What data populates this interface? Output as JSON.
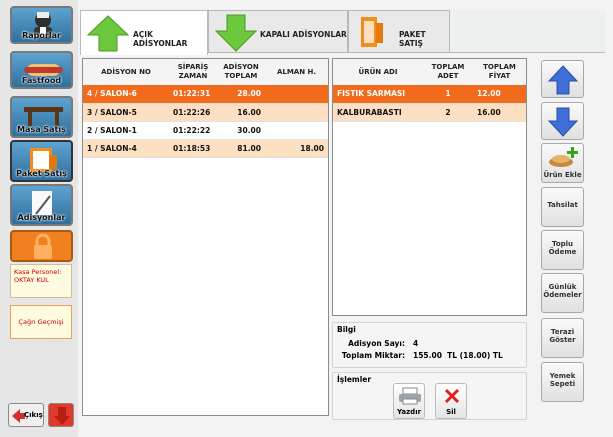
{
  "sidebar": {
    "reports_label": "Raporlar",
    "fastfood_label": "Fastfood",
    "table_sales_label": "Masa Satış",
    "package_sales_label": "Paket Satış",
    "bills_label": "Adisyonlar",
    "cashier_label": "Kasa Personel:",
    "cashier_name": "OKTAY KUL",
    "call_history_label": "Çağrı Geçmişi",
    "exit_label": "Çıkış"
  },
  "tabs": [
    {
      "label": "AÇIK ADİSYONLAR",
      "active": true
    },
    {
      "label": "KAPALI ADİSYONLAR",
      "active": false
    },
    {
      "label": "PAKET SATIŞ",
      "active": false
    }
  ],
  "bills_table": {
    "headers": [
      "ADİSYON NO",
      "SİPARİŞ ZAMAN",
      "ADİSYON TOPLAM",
      "ALMAN H."
    ],
    "rows": [
      {
        "no": "4 / SALON-6",
        "time": "01:22:31",
        "total": "28.00",
        "received": "",
        "style": "selected"
      },
      {
        "no": "3 / SALON-5",
        "time": "01:22:26",
        "total": "16.00",
        "received": "",
        "style": "peach"
      },
      {
        "no": "2 / SALON-1",
        "time": "01:22:22",
        "total": "30.00",
        "received": "",
        "style": "white"
      },
      {
        "no": "1 / SALON-4",
        "time": "01:18:53",
        "total": "81.00",
        "received": "18.00",
        "style": "peach"
      }
    ]
  },
  "products_table": {
    "headers": [
      "ÜRÜN ADI",
      "TOPLAM ADET",
      "TOPLAM FİYAT"
    ],
    "rows": [
      {
        "name": "FISTIK SARMASI",
        "qty": "1",
        "price": "12.00",
        "style": "selected"
      },
      {
        "name": "KALBURABASTI",
        "qty": "2",
        "price": "16.00",
        "style": "peach"
      }
    ]
  },
  "info": {
    "title": "Bilgi",
    "count_label": "Adisyon Sayı:",
    "count_value": "4",
    "total_label": "Toplam Miktar:",
    "total_value": "155.00  TL (18.00) TL"
  },
  "operations": {
    "title": "İşlemler",
    "print_label": "Yazdır",
    "delete_label": "Sil"
  },
  "right_buttons": {
    "add_product": "Ürün Ekle",
    "collect": "Tahsilat",
    "bulk_payment_1": "Toplu",
    "bulk_payment_2": "Ödeme",
    "daily_payments_1": "Günlük",
    "daily_payments_2": "Ödemeler",
    "scale_1": "Terazi",
    "scale_2": "Göster",
    "meal_1": "Yemek",
    "meal_2": "Sepeti"
  },
  "colors": {
    "selected_row": "#f26a1b",
    "peach_row": "#fde0c2",
    "accent_blue": "#3e6fd8",
    "arrow_green": "#6cc83c",
    "orange_icon": "#f28c1a"
  }
}
